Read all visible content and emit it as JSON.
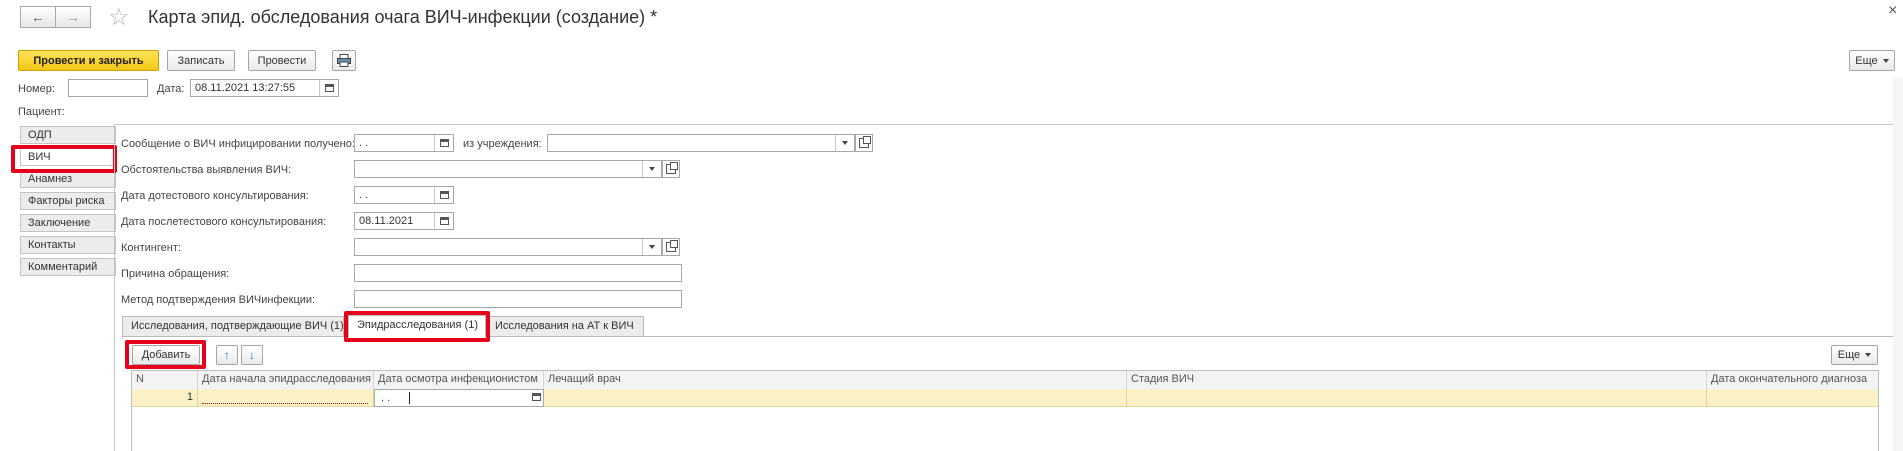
{
  "window": {
    "title": "Карта эпид. обследования очага ВИЧ-инфекции (создание) *",
    "back_icon": "←",
    "forward_icon": "→",
    "star_icon": "☆",
    "close_icon": "×"
  },
  "toolbar": {
    "post_close": "Провести и закрыть",
    "write": "Записать",
    "post": "Провести",
    "more": "Еще"
  },
  "header": {
    "number_label": "Номер:",
    "number_value": "",
    "date_label": "Дата:",
    "date_value": "08.11.2021 13:27:55",
    "patient_label": "Пациент:"
  },
  "side_tabs": [
    {
      "label": "ОДП"
    },
    {
      "label": "ВИЧ"
    },
    {
      "label": "Анамнез"
    },
    {
      "label": "Факторы риска"
    },
    {
      "label": "Заключение"
    },
    {
      "label": "Контакты"
    },
    {
      "label": "Комментарий"
    }
  ],
  "form": {
    "message_label": "Сообщение о ВИЧ инфицировании получено:",
    "message_date": " .  .",
    "from_label": "из учреждения:",
    "from_value": "",
    "circumstances_label": "Обстоятельства выявления ВИЧ:",
    "circumstances_value": "",
    "pretest_label": "Дата дотестового консультирования:",
    "pretest_value": " .  .",
    "posttest_label": "Дата послетестового консультирования:",
    "posttest_value": "08.11.2021",
    "contingent_label": "Контингент:",
    "contingent_value": "",
    "reason_label": "Причина обращения:",
    "reason_value": "",
    "method_label": "Метод подтверждения ВИЧинфекции:",
    "method_value": ""
  },
  "inner_tabs": [
    {
      "label": "Исследования, подтверждающие ВИЧ (1)"
    },
    {
      "label": "Эпидрасследования (1)"
    },
    {
      "label": "Исследования на АТ к ВИЧ"
    }
  ],
  "table_toolbar": {
    "add": "Добавить",
    "up_icon": "↑",
    "down_icon": "↓",
    "more": "Еще"
  },
  "table": {
    "columns": [
      "N",
      "Дата начала эпидрасследования",
      "Дата осмотра инфекционистом",
      "Лечащий врач",
      "Стадия ВИЧ",
      "Дата окончательного диагноза"
    ],
    "rows": [
      {
        "n": "1",
        "start_date": "",
        "exam_date": " .  .",
        "doctor": "",
        "stage": "",
        "final_date": ""
      }
    ]
  }
}
